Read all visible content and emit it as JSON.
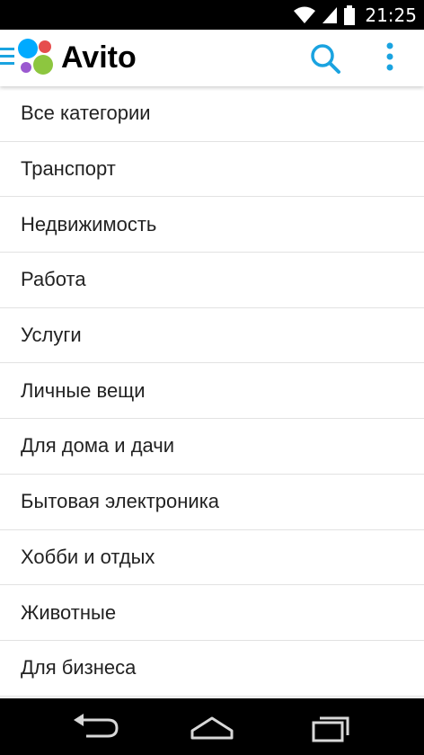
{
  "status_bar": {
    "time": "21:25",
    "icons": [
      "wifi-icon",
      "cell-signal-icon",
      "battery-icon"
    ]
  },
  "app_bar": {
    "logo_text": "Avito",
    "logo_dot_colors": [
      "#0af",
      "#e64d4d",
      "#9b59d0",
      "#8dc63f"
    ],
    "accent_color": "#1aa3e0",
    "icons": [
      "hamburger-menu-icon",
      "search-icon",
      "more-vert-icon"
    ]
  },
  "categories": [
    {
      "label": "Все категории"
    },
    {
      "label": "Транспорт"
    },
    {
      "label": "Недвижимость"
    },
    {
      "label": "Работа"
    },
    {
      "label": "Услуги"
    },
    {
      "label": "Личные вещи"
    },
    {
      "label": "Для дома и дачи"
    },
    {
      "label": "Бытовая электроника"
    },
    {
      "label": "Хобби и отдых"
    },
    {
      "label": "Животные"
    },
    {
      "label": "Для бизнеса"
    }
  ],
  "nav_bar": {
    "icons": [
      "back-icon",
      "home-icon",
      "recent-apps-icon"
    ]
  }
}
